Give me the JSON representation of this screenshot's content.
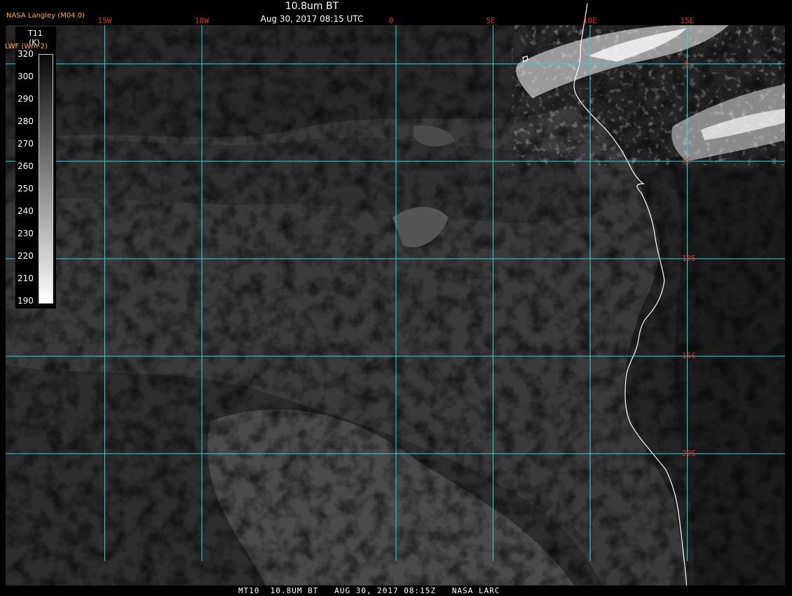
{
  "header": {
    "title": "10.8um BT",
    "subtitle": "Aug 30, 2017 08:15 UTC",
    "provider": "NASA Langley (M04.0)",
    "alt_product": "LWF (Wm-2)"
  },
  "colorbar": {
    "title": "T11",
    "unit": "(K)",
    "ticks": [
      "320",
      "300",
      "290",
      "280",
      "270",
      "260",
      "250",
      "240",
      "230",
      "220",
      "210",
      "190"
    ]
  },
  "grid": {
    "longitudes": [
      {
        "label": "15W",
        "value": -15
      },
      {
        "label": "10W",
        "value": -10
      },
      {
        "label": "0",
        "value": 0
      },
      {
        "label": "5E",
        "value": 5
      },
      {
        "label": "10E",
        "value": 10
      },
      {
        "label": "15E",
        "value": 15
      }
    ],
    "latitudes": [
      {
        "label": "0",
        "value": 0
      },
      {
        "label": "5S",
        "value": -5
      },
      {
        "label": "10S",
        "value": -10
      },
      {
        "label": "15S",
        "value": -15
      },
      {
        "label": "20S",
        "value": -20
      }
    ],
    "line_color": "#2fd6d6",
    "label_color": "#e03030"
  },
  "footer": {
    "text": "MT10  10.8UM BT   AUG 30, 2017 08:15Z   NASA LARC"
  },
  "colors": {
    "coastline": "#ffffff",
    "ocean": "#3a3a3a",
    "cloud_dark": "#262626",
    "cloud_bright": "#e8e8e8"
  }
}
